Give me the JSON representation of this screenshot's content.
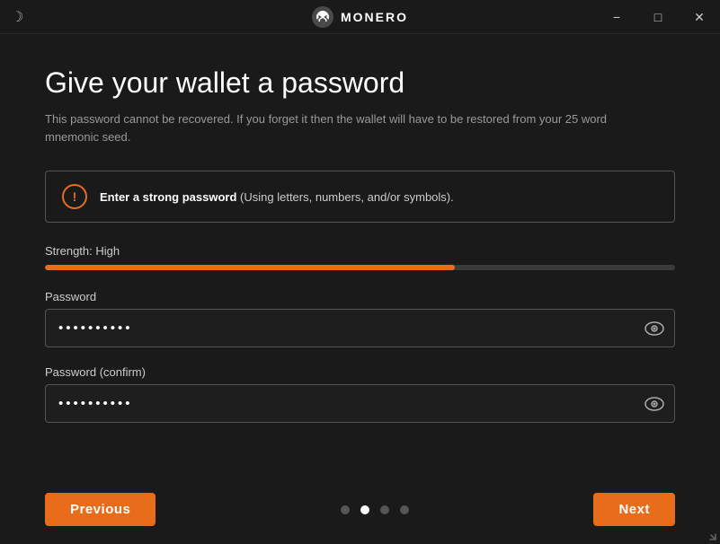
{
  "titlebar": {
    "title": "MONERO",
    "minimize_label": "−",
    "maximize_label": "□",
    "close_label": "✕"
  },
  "page": {
    "title": "Give your wallet a password",
    "subtitle": "This password cannot be recovered. If you forget it then the wallet will have to be restored from your 25 word mnemonic seed.",
    "info_text_bold": "Enter a strong password",
    "info_text_rest": " (Using letters, numbers, and/or symbols).",
    "strength_label": "Strength: High",
    "strength_percent": 65,
    "password_label": "Password",
    "password_value": "••••••••••",
    "password_confirm_label": "Password (confirm)",
    "password_confirm_value": "••••••••••"
  },
  "navigation": {
    "previous_label": "Previous",
    "next_label": "Next"
  },
  "pagination": {
    "dots": [
      false,
      true,
      false,
      false
    ]
  },
  "icons": {
    "moon": "☽",
    "info_exclamation": "!",
    "eye": "👁"
  }
}
